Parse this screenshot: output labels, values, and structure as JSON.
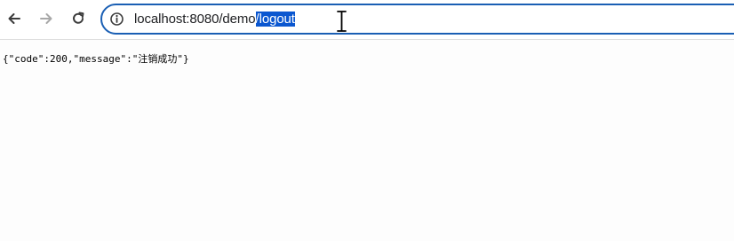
{
  "browser": {
    "url_base": "localhost:8080/demo",
    "url_selected": "/logout"
  },
  "page": {
    "body_text": "{\"code\":200,\"message\":\"注销成功\"}"
  },
  "colors": {
    "omnibox_border": "#1a5fb4",
    "selection": "#0b57d0",
    "background": "#fdfdfd"
  },
  "icons": {
    "back": "back-arrow-icon",
    "forward": "forward-arrow-icon",
    "reload": "reload-icon",
    "site_info": "info-icon",
    "cursor": "text-cursor-icon"
  }
}
